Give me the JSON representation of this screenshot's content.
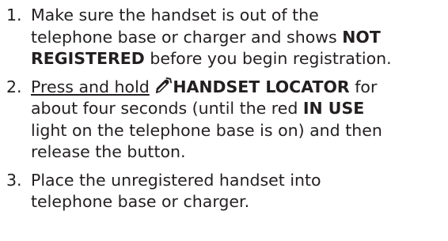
{
  "steps": [
    {
      "number": "1.",
      "line1": "Make sure the handset is out of the",
      "line2a": "telephone base or charger and shows ",
      "line2b": "NOT",
      "line3a": "REGISTERED",
      "line3b": " before you begin registration."
    },
    {
      "number": "2.",
      "action": "Press and hold",
      "icon": "handset-locator-icon",
      "button": "HANDSET LOCATOR",
      "line1c": " for",
      "line2a": "about four seconds (until the red ",
      "line2b": "IN USE",
      "line3": "light on the telephone base is on) and then",
      "line4": "release the button."
    },
    {
      "number": "3.",
      "line1": "Place the unregistered handset into",
      "line2": "telephone base or charger."
    }
  ]
}
